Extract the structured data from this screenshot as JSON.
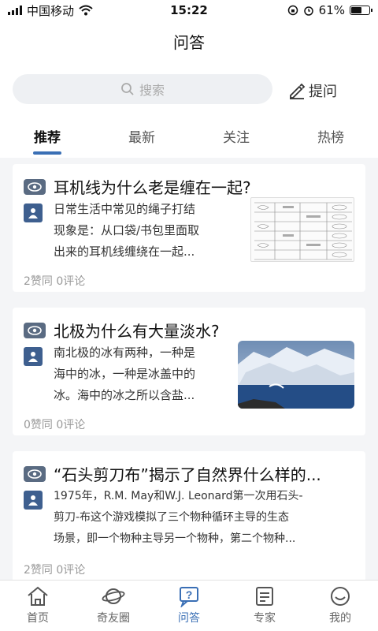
{
  "status_bar": {
    "carrier": "中国移动",
    "time": "15:22",
    "battery": "61%",
    "battery_level": 0.61
  },
  "header": {
    "title": "问答",
    "search_placeholder": "搜索",
    "ask_label": "提问"
  },
  "tabs": [
    {
      "label": "推荐",
      "active": true
    },
    {
      "label": "最新",
      "active": false
    },
    {
      "label": "关注",
      "active": false
    },
    {
      "label": "热榜",
      "active": false
    }
  ],
  "feed": [
    {
      "title": "耳机线为什么老是缠在一起?",
      "excerpt": [
        "日常生活中常见的绳子打结",
        "现象是：从口袋/书包里面取",
        "出来的耳机线缠绕在一起..."
      ],
      "meta": "2赞同 0评论",
      "thumbnail": "knot-table-image"
    },
    {
      "title": "北极为什么有大量淡水?",
      "excerpt": [
        "南北极的冰有两种，一种是",
        "海中的冰，一种是冰盖中的",
        "冰。海中的冰之所以含盐..."
      ],
      "meta": "0赞同 0评论",
      "thumbnail": "arctic-ice-image"
    },
    {
      "title": "“石头剪刀布”揭示了自然界什么样的...",
      "excerpt": [
        "1975年，R.M. May和W.J. Leonard第一次用石头-",
        "剪刀-布这个游戏模拟了三个物种循环主导的生态",
        "场景，即一个物种主导另一个物种，第二个物种..."
      ],
      "meta": "2赞同 0评论"
    }
  ],
  "tabbar": [
    {
      "label": "首页",
      "icon": "home-icon",
      "active": false
    },
    {
      "label": "奇友圈",
      "icon": "planet-icon",
      "active": false
    },
    {
      "label": "问答",
      "icon": "qa-icon",
      "active": true
    },
    {
      "label": "专家",
      "icon": "expert-icon",
      "active": false
    },
    {
      "label": "我的",
      "icon": "profile-icon",
      "active": false
    }
  ],
  "colors": {
    "accent": "#3a6fb5",
    "muted": "#999999",
    "badge": "#5a6b82"
  }
}
